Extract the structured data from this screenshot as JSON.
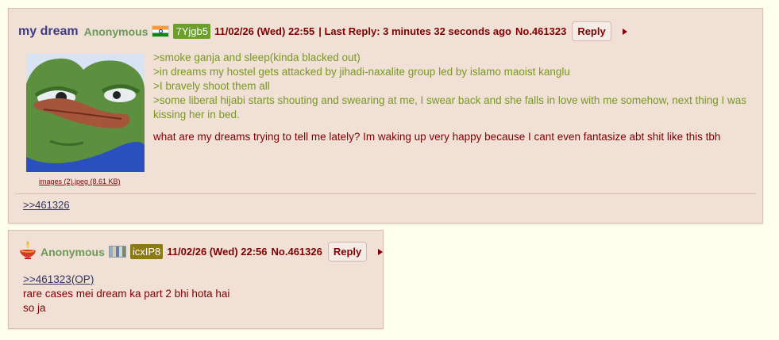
{
  "op": {
    "subject": "my dream",
    "name": "Anonymous",
    "flag_icon": "india-flag-icon",
    "poster_id": "7Yjgb5",
    "datetime": "11/02/26 (Wed) 22:55",
    "last_reply": "| Last Reply: 3 minutes 32 seconds ago",
    "post_no": "No.461323",
    "reply_label": "Reply",
    "file_info": "images (2).jpeg (8.61 KB)",
    "greentext": [
      ">smoke ganja and sleep(kinda blacked out)",
      ">in dreams my hostel gets attacked by jihadi-naxalite group led by islamo maoist kanglu",
      ">I bravely shoot them all",
      ">some liberal hijabi starts shouting and swearing at me, I swear back and she falls in love with me somehow, next thing I was kissing her in bed."
    ],
    "body": "what are my dreams trying to tell me lately? Im waking up very happy because I cant even fantasize abt shit like this tbh",
    "backlink": ">>461326"
  },
  "reply": {
    "name": "Anonymous",
    "flag_icon": "pixel-flag-icon",
    "poster_id": "icxIP8",
    "datetime": "11/02/26 (Wed) 22:56",
    "post_no": "No.461326",
    "reply_label": "Reply",
    "quote": ">>461323(OP)",
    "lines": [
      "rare cases mei dream ka part 2 bhi hota hai",
      "so ja"
    ]
  },
  "colors": {
    "background": "#ffffee",
    "post_bg": "#f0e0d6",
    "greentext": "#789922",
    "subject": "#3f3a84",
    "name": "#6a9a55",
    "id_green": "#6a9f2a",
    "id_olive": "#8c7a12"
  }
}
